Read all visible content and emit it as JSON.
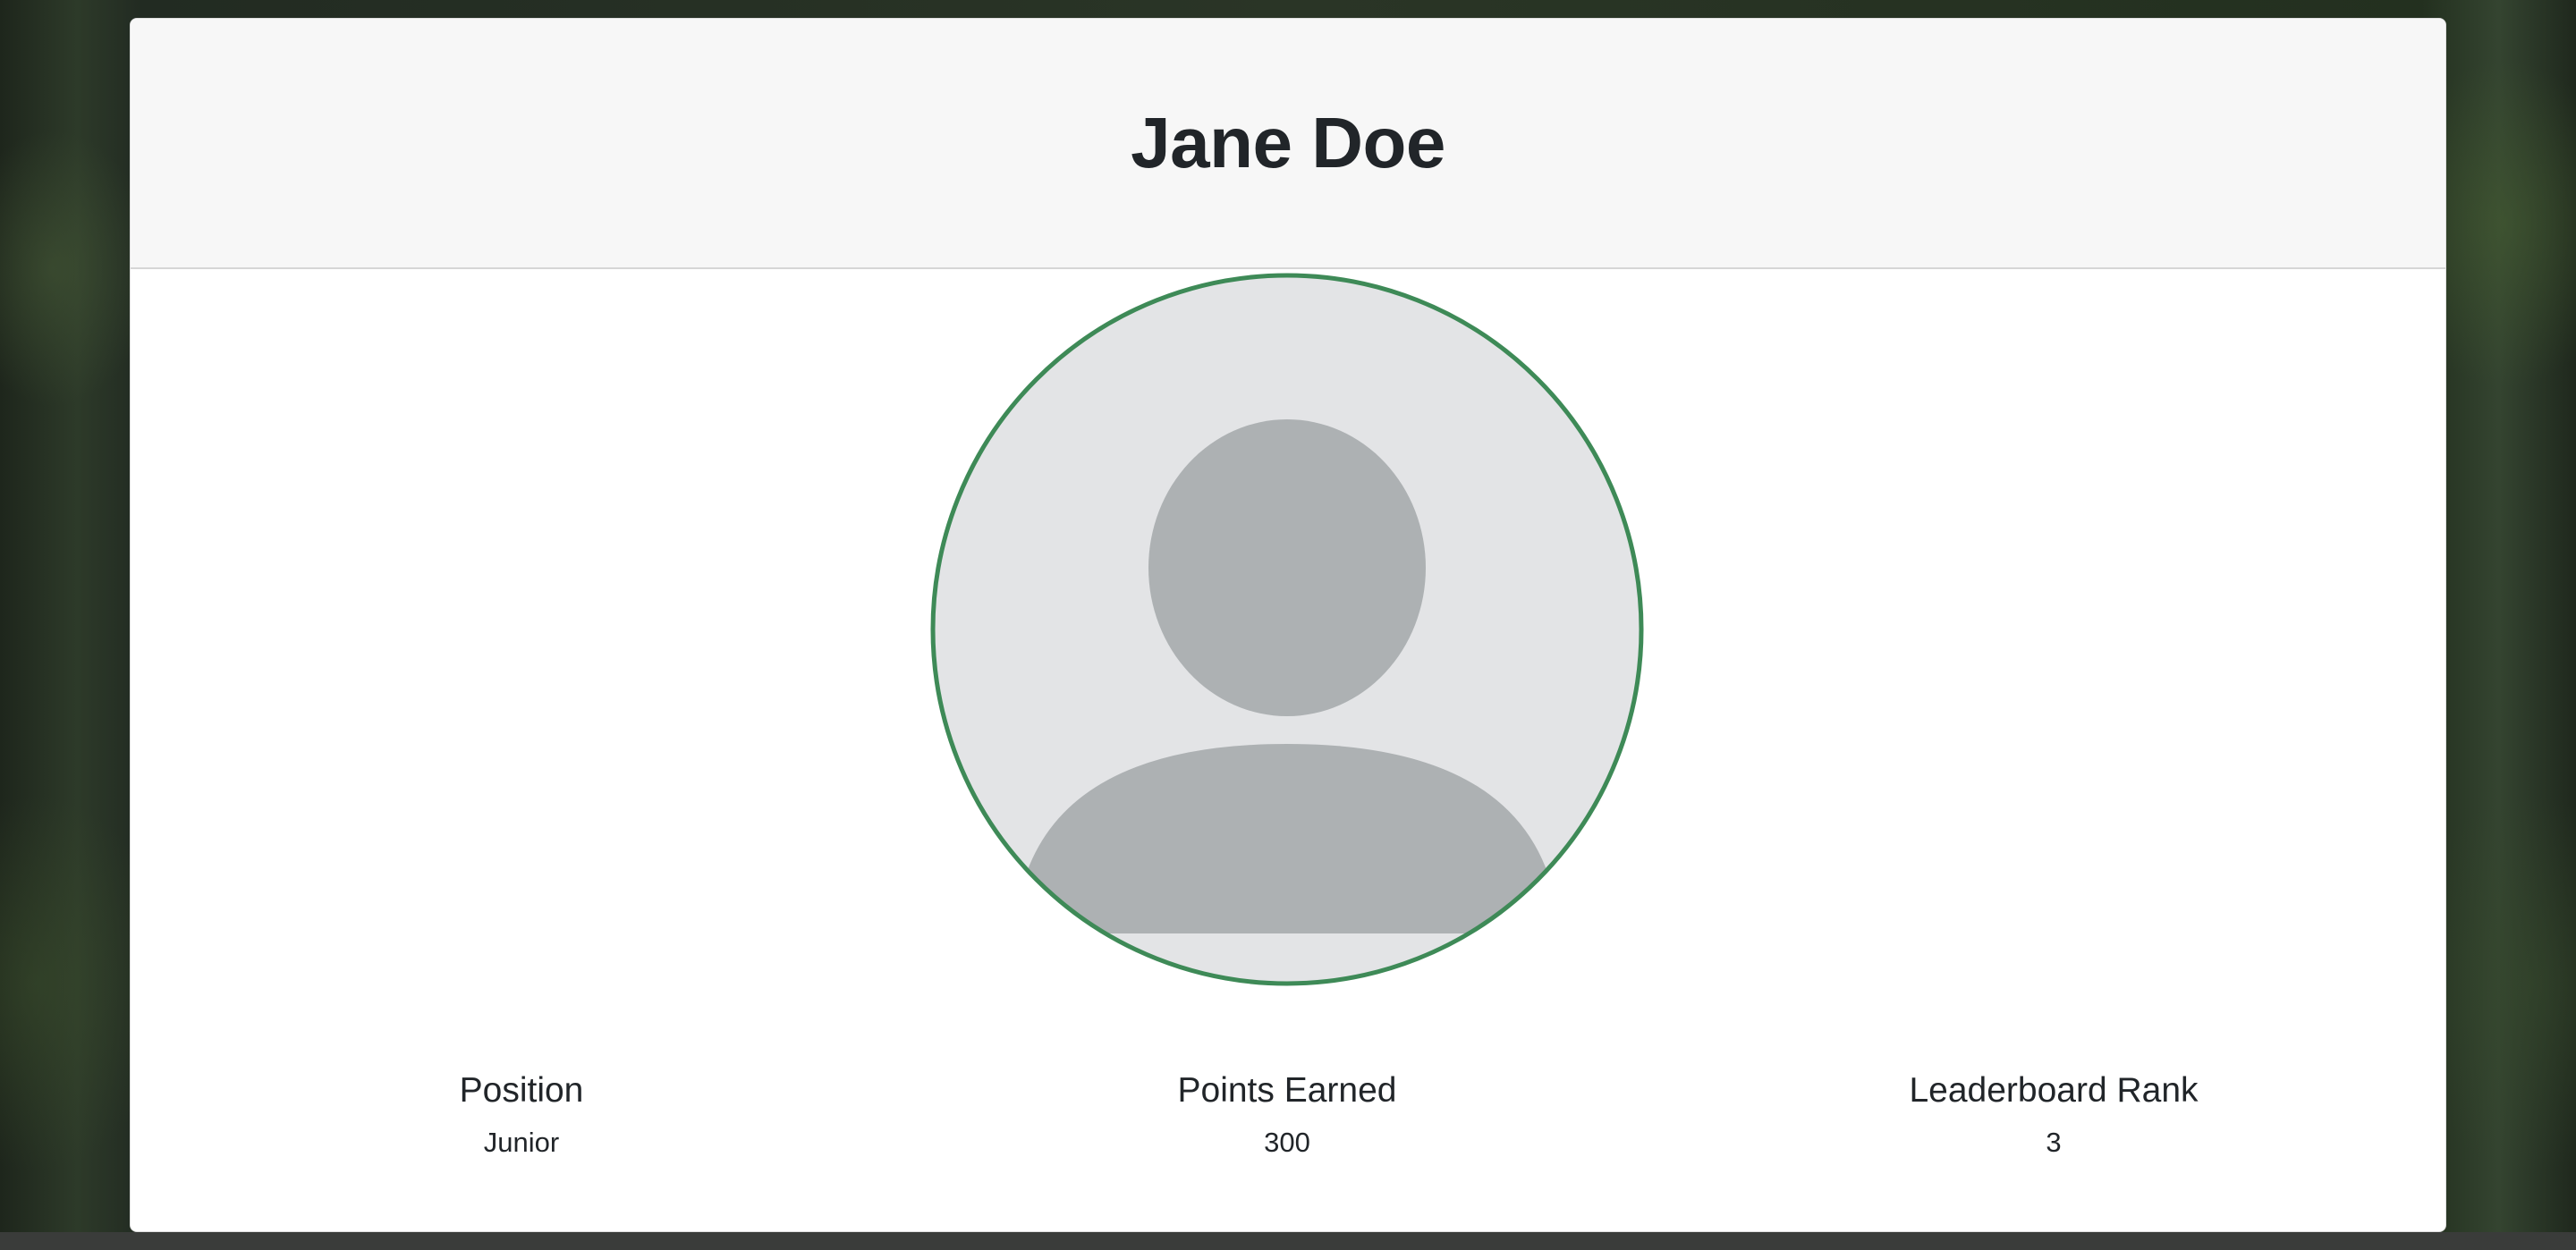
{
  "profile": {
    "name": "Jane Doe",
    "avatar_icon": "default-user-avatar-icon",
    "avatar_border_color": "#3e8a57"
  },
  "stats": [
    {
      "label": "Position",
      "value": "Junior"
    },
    {
      "label": "Points Earned",
      "value": "300"
    },
    {
      "label": "Leaderboard Rank",
      "value": "3"
    }
  ]
}
